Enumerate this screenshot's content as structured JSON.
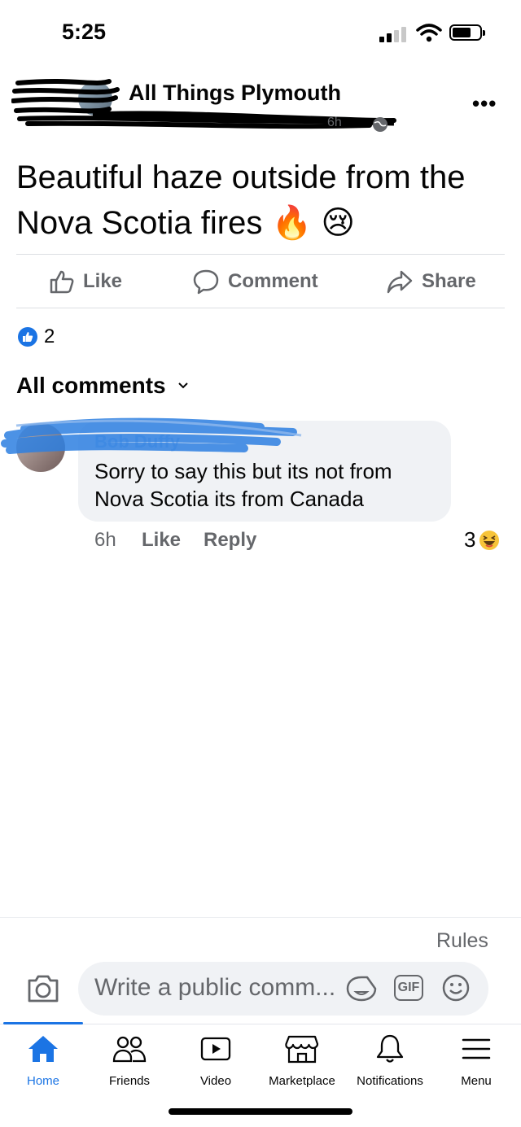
{
  "status_bar": {
    "time": "5:25"
  },
  "post": {
    "group_name": "All Things Plymouth",
    "timestamp": "6h",
    "text": "Beautiful haze outside from the Nova Scotia fires 🔥 😢",
    "actions": {
      "like": "Like",
      "comment": "Comment",
      "share": "Share"
    },
    "reaction_count": "2"
  },
  "comments": {
    "header": "All comments",
    "items": [
      {
        "author": "Bob Duffy",
        "text": "Sorry to say this but its not from Nova Scotia its from Canada",
        "time": "6h",
        "like_label": "Like",
        "reply_label": "Reply",
        "reaction_count": "3"
      }
    ]
  },
  "composer": {
    "rules_label": "Rules",
    "placeholder": "Write a public comm...",
    "gif_label": "GIF"
  },
  "tab_bar": {
    "tabs": [
      {
        "label": "Home",
        "icon": "home-icon",
        "active": true
      },
      {
        "label": "Friends",
        "icon": "friends-icon"
      },
      {
        "label": "Video",
        "icon": "video-icon"
      },
      {
        "label": "Marketplace",
        "icon": "marketplace-icon"
      },
      {
        "label": "Notifications",
        "icon": "bell-icon"
      },
      {
        "label": "Menu",
        "icon": "menu-icon"
      }
    ]
  },
  "colors": {
    "accent": "#1b74e4",
    "secondary_text": "#65676b",
    "bubble": "#f0f2f5"
  }
}
